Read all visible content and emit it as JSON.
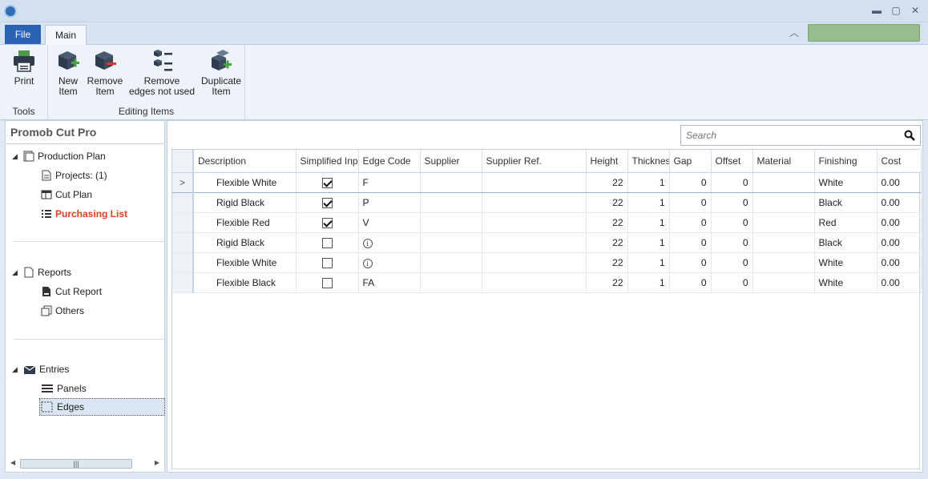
{
  "window": {
    "controls": [
      "minimize",
      "maximize",
      "close"
    ]
  },
  "tabs": {
    "file": "File",
    "main": "Main"
  },
  "ribbon": {
    "groups": [
      {
        "label": "Tools",
        "buttons": [
          {
            "label": "Print",
            "icon": "printer-icon"
          }
        ]
      },
      {
        "label": "Editing Items",
        "buttons": [
          {
            "label": "New\nItem",
            "icon": "new-item-icon"
          },
          {
            "label": "Remove\nItem",
            "icon": "remove-item-icon"
          },
          {
            "label": "Remove\nedges not used",
            "icon": "remove-edges-icon"
          },
          {
            "label": "Duplicate\nItem",
            "icon": "duplicate-item-icon"
          }
        ]
      }
    ]
  },
  "sidebar": {
    "title": "Promob Cut Pro",
    "production_plan": "Production Plan",
    "projects": "Projects: (1)",
    "cut_plan": "Cut Plan",
    "purchasing_list": "Purchasing List",
    "reports": "Reports",
    "cut_report": "Cut Report",
    "others": "Others",
    "entries": "Entries",
    "panels": "Panels",
    "edges": "Edges"
  },
  "search": {
    "placeholder": "Search"
  },
  "grid": {
    "columns": [
      "Description",
      "Simplified Input",
      "Edge Code",
      "Supplier",
      "Supplier Ref.",
      "Height",
      "Thickness",
      "Gap",
      "Offset",
      "Material",
      "Finishing",
      "Cost"
    ],
    "current_row_marker": ">",
    "rows": [
      {
        "description": "Flexible White",
        "simplified": true,
        "edge_code": "F",
        "edge_code_icon": false,
        "supplier": "",
        "supplier_ref": "",
        "height": "22",
        "thickness": "1",
        "gap": "0",
        "offset": "0",
        "material": "",
        "finishing": "White",
        "cost": "0.00"
      },
      {
        "description": "Rigid Black",
        "simplified": true,
        "edge_code": "P",
        "edge_code_icon": false,
        "supplier": "",
        "supplier_ref": "",
        "height": "22",
        "thickness": "1",
        "gap": "0",
        "offset": "0",
        "material": "",
        "finishing": "Black",
        "cost": "0.00"
      },
      {
        "description": "Flexible Red",
        "simplified": true,
        "edge_code": "V",
        "edge_code_icon": false,
        "supplier": "",
        "supplier_ref": "",
        "height": "22",
        "thickness": "1",
        "gap": "0",
        "offset": "0",
        "material": "",
        "finishing": "Red",
        "cost": "0.00"
      },
      {
        "description": "Rigid Black",
        "simplified": false,
        "edge_code": "",
        "edge_code_icon": true,
        "supplier": "",
        "supplier_ref": "",
        "height": "22",
        "thickness": "1",
        "gap": "0",
        "offset": "0",
        "material": "",
        "finishing": "Black",
        "cost": "0.00"
      },
      {
        "description": "Flexible White",
        "simplified": false,
        "edge_code": "",
        "edge_code_icon": true,
        "supplier": "",
        "supplier_ref": "",
        "height": "22",
        "thickness": "1",
        "gap": "0",
        "offset": "0",
        "material": "",
        "finishing": "White",
        "cost": "0.00"
      },
      {
        "description": "Flexible Black",
        "simplified": false,
        "edge_code": "FA",
        "edge_code_icon": false,
        "supplier": "",
        "supplier_ref": "",
        "height": "22",
        "thickness": "1",
        "gap": "0",
        "offset": "0",
        "material": "",
        "finishing": "White",
        "cost": "0.00"
      }
    ]
  },
  "colors": {
    "accent": "#2b61b3",
    "highlight_red": "#e53c1a",
    "status_green": "#97bd8f"
  }
}
